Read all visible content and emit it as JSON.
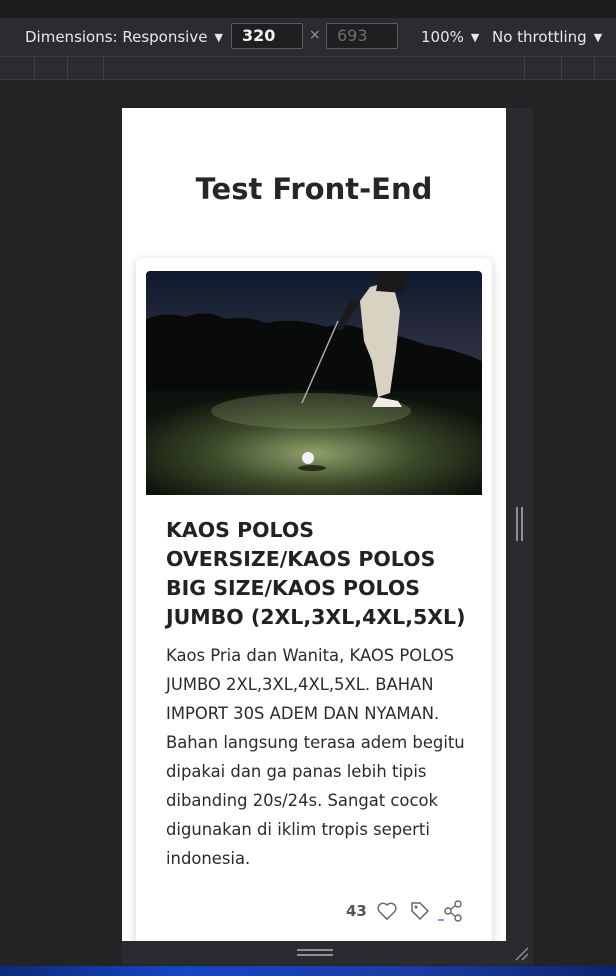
{
  "devtools": {
    "dimensions_label": "Dimensions: Responsive",
    "width_value": "320",
    "height_value": "693",
    "times": "×",
    "zoom_label": "100%",
    "throttle_label": "No throttling",
    "caret": "▼"
  },
  "page": {
    "title": "Test Front-End"
  },
  "card": {
    "image_icon": "golf-photo",
    "title": "KAOS POLOS OVERSIZE/KAOS POLOS BIG SIZE/KAOS POLOS JUMBO (2XL,3XL,4XL,5XL)",
    "description": "Kaos Pria dan Wanita, KAOS POLOS JUMBO 2XL,3XL,4XL,5XL. BAHAN IMPORT 30S ADEM DAN NYAMAN. Bahan langsung terasa adem begitu dipakai dan ga panas lebih tipis dibanding 20s/24s. Sangat cocok digunakan di iklim tropis seperti indonesia.",
    "like_count": "43",
    "icons": [
      "heart-icon",
      "tag-icon",
      "share-icon"
    ]
  }
}
